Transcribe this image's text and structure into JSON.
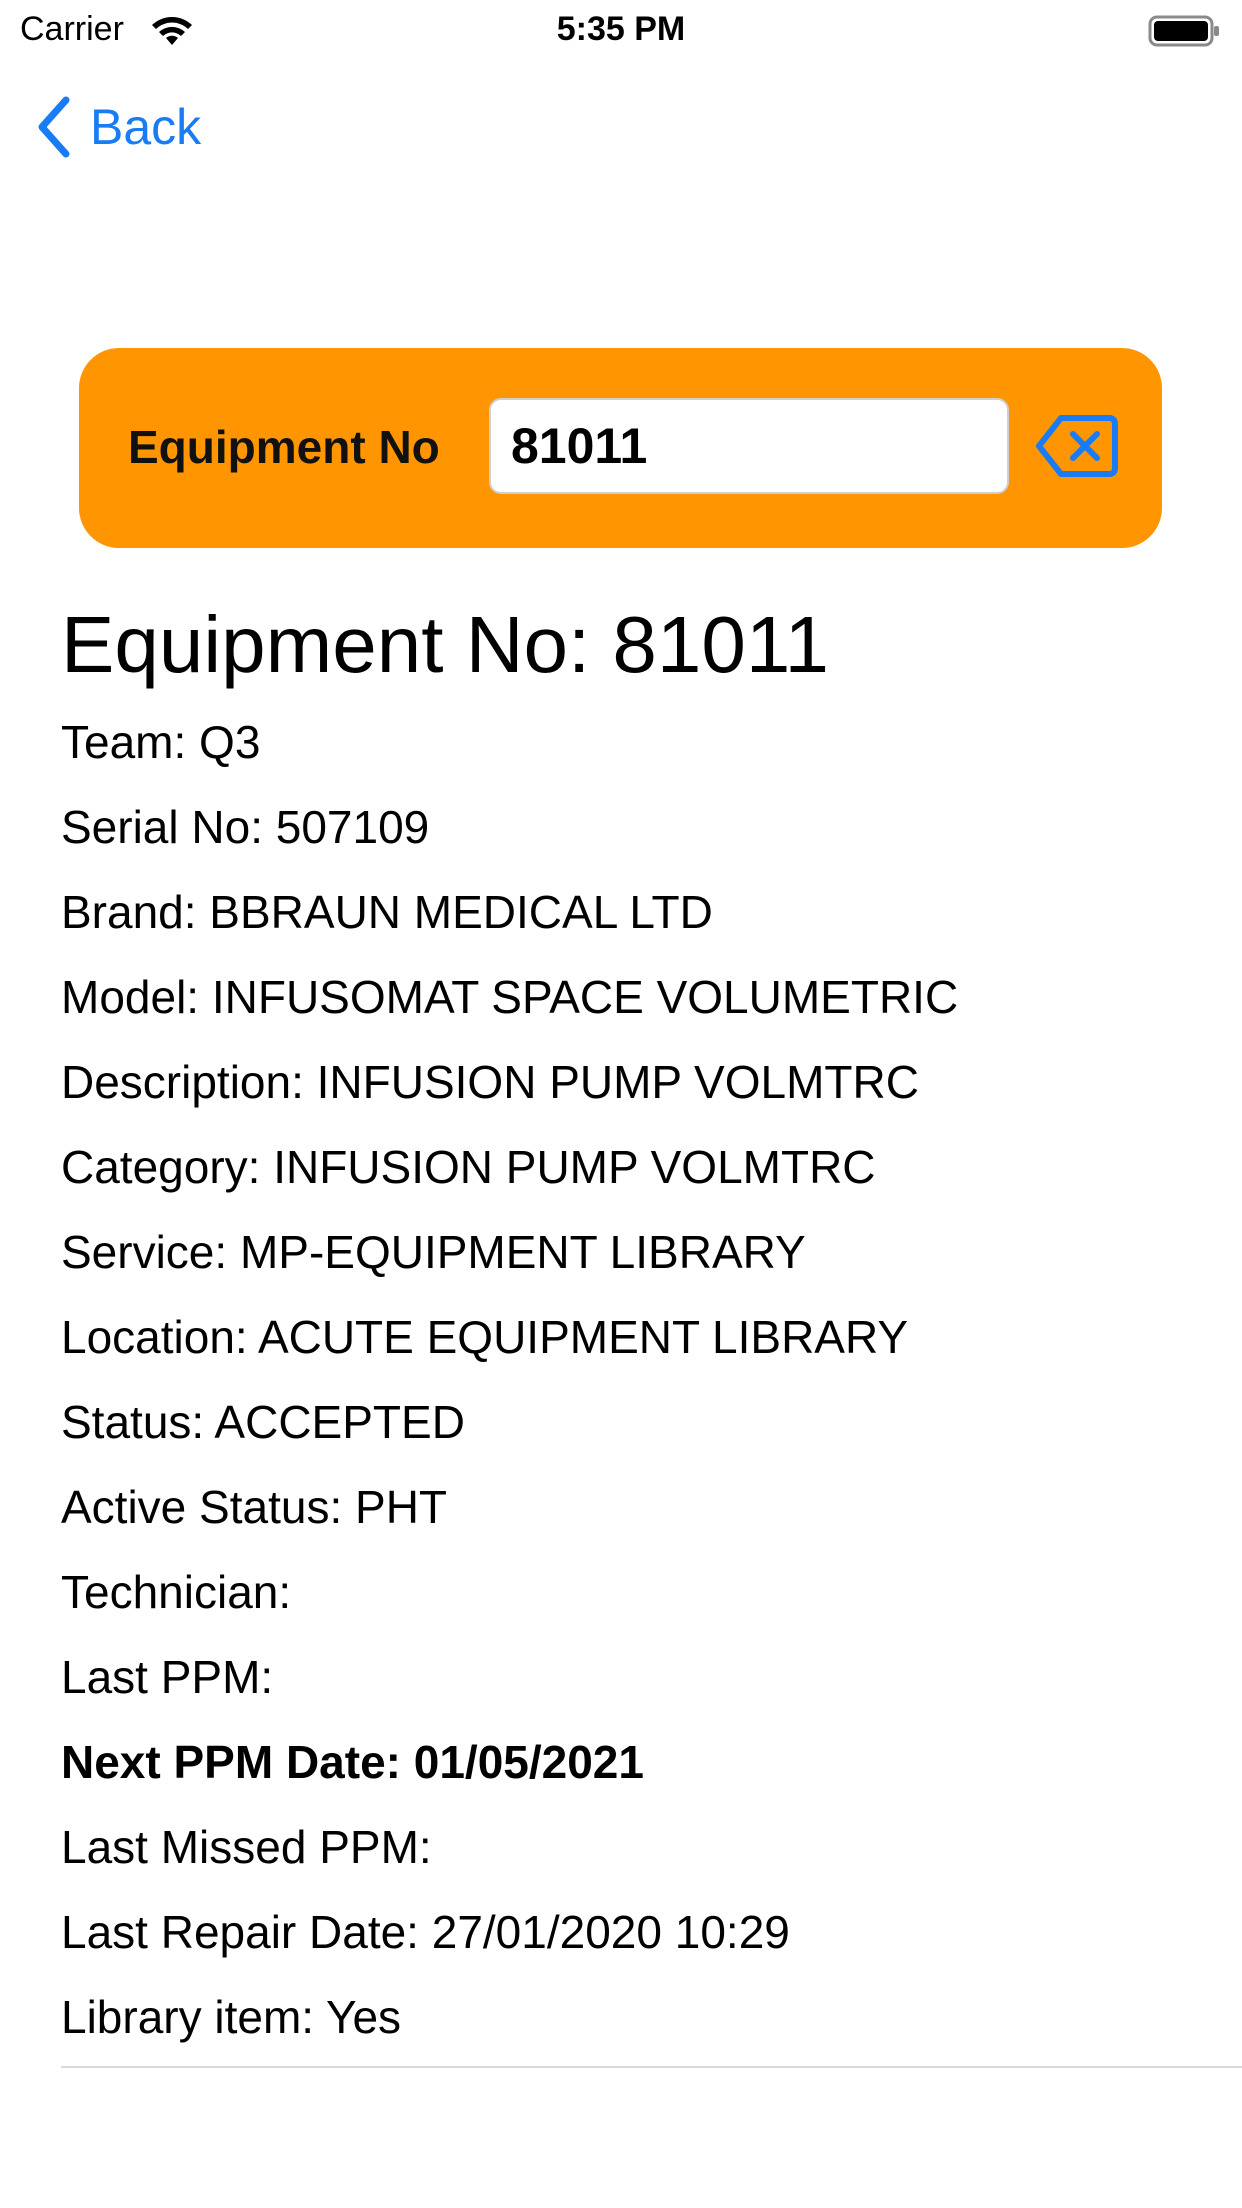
{
  "status_bar": {
    "carrier": "Carrier",
    "time": "5:35 PM"
  },
  "nav": {
    "back_label": "Back"
  },
  "search": {
    "label": "Equipment No",
    "value": "81011",
    "clear_icon": "delete-left-icon"
  },
  "details": {
    "title": "Equipment No: 81011",
    "rows": [
      {
        "text": "Team: Q3"
      },
      {
        "text": "Serial No: 507109"
      },
      {
        "text": "Brand: BBRAUN MEDICAL LTD"
      },
      {
        "text": "Model: INFUSOMAT SPACE VOLUMETRIC"
      },
      {
        "text": "Description: INFUSION PUMP VOLMTRC"
      },
      {
        "text": "Category: INFUSION PUMP VOLMTRC"
      },
      {
        "text": "Service: MP-EQUIPMENT LIBRARY"
      },
      {
        "text": "Location: ACUTE EQUIPMENT LIBRARY"
      },
      {
        "text": "Status: ACCEPTED"
      },
      {
        "text": "Active Status: PHT"
      },
      {
        "text": "Technician:"
      },
      {
        "text": "Last PPM:"
      },
      {
        "text": "Next PPM Date: 01/05/2021"
      },
      {
        "text": "Last Missed PPM:"
      },
      {
        "text": "Last Repair Date: 27/01/2020 10:29"
      },
      {
        "text": "Library item: Yes"
      }
    ]
  },
  "colors": {
    "accent": "#1a7cf4",
    "panel": "#ff9500"
  }
}
